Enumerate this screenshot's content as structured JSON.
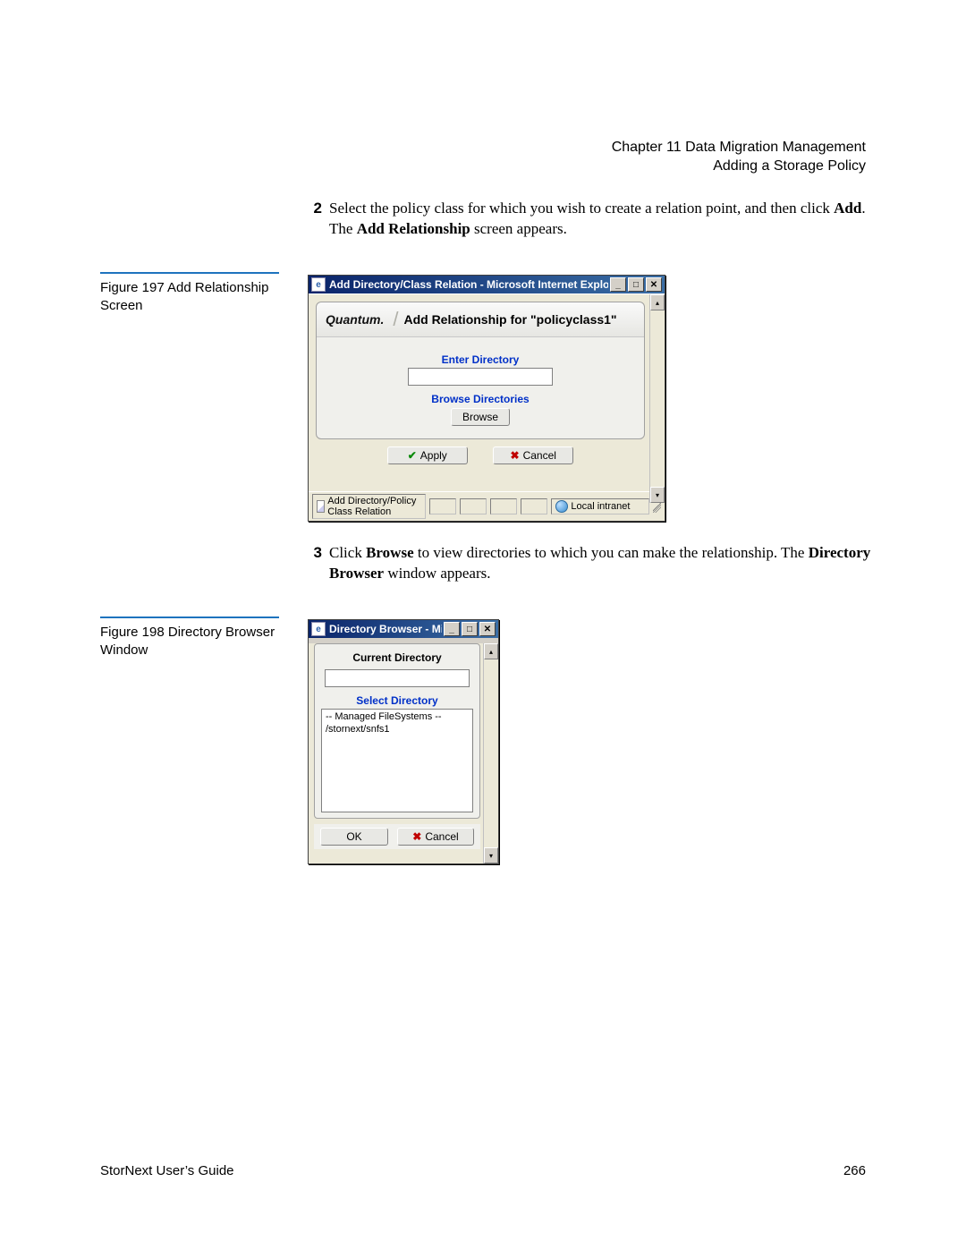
{
  "header": {
    "chapter_line": "Chapter 11  Data Migration Management",
    "section_line": "Adding a Storage Policy"
  },
  "steps": {
    "s2": {
      "num": "2",
      "pre": "Select the policy class for which you wish to create a relation point, and then click ",
      "add": "Add",
      "mid": ". The ",
      "add_rel": "Add Relationship",
      "post": " screen appears."
    },
    "s3": {
      "num": "3",
      "pre": "Click ",
      "browse": "Browse",
      "mid": " to view directories to which you can make the relationship. The ",
      "db": "Directory Browser",
      "post": " window appears."
    }
  },
  "figs": {
    "f1": "Figure 197  Add Relationship Screen",
    "f2": "Figure 198  Directory Browser Window"
  },
  "win1": {
    "title": "Add Directory/Class Relation - Microsoft Internet Explorer",
    "brand": "Quantum.",
    "heading": "Add Relationship for \"policyclass1\"",
    "enter_dir": "Enter Directory",
    "browse_dirs": "Browse Directories",
    "browse_btn": "Browse",
    "apply_btn": "Apply",
    "cancel_btn": "Cancel",
    "status_left": "Add Directory/Policy Class Relation",
    "status_zone": "Local intranet"
  },
  "win2": {
    "title": "Directory Browser - Microsoft Int...",
    "current_dir": "Current Directory",
    "select_dir": "Select Directory",
    "list_line1": "-- Managed FileSystems --",
    "list_line2": "/stornext/snfs1",
    "ok_btn": "OK",
    "cancel_btn": "Cancel"
  },
  "footer": {
    "left": "StorNext User’s Guide",
    "right": "266"
  },
  "icons": {
    "min": "_",
    "max": "□",
    "close": "✕",
    "up": "▴",
    "down": "▾",
    "check": "✔",
    "x": "✖"
  }
}
